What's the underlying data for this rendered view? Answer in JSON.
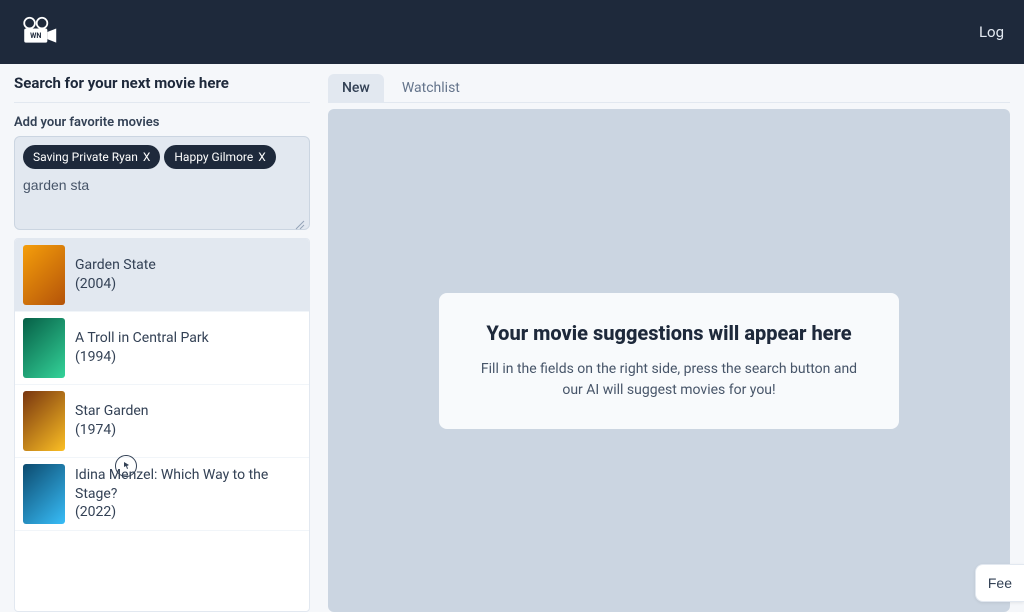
{
  "header": {
    "logo_label": "WN",
    "login_label": "Log"
  },
  "sidebar": {
    "heading": "Search for your next movie here",
    "field_label": "Add your favorite movies",
    "tags": [
      {
        "label": "Saving Private Ryan",
        "close": "X"
      },
      {
        "label": "Happy Gilmore",
        "close": "X"
      }
    ],
    "search_value": "garden sta",
    "suggestions": [
      {
        "title": "Garden State",
        "year": "(2004)",
        "hovered": true
      },
      {
        "title": "A Troll in Central Park",
        "year": "(1994)",
        "hovered": false
      },
      {
        "title": "Star Garden",
        "year": "(1974)",
        "hovered": false
      },
      {
        "title": "Idina Menzel: Which Way to the Stage?",
        "year": "(2022)",
        "hovered": false
      }
    ]
  },
  "tabs": [
    {
      "label": "New",
      "active": true
    },
    {
      "label": "Watchlist",
      "active": false
    }
  ],
  "empty_state": {
    "title": "Your movie suggestions will appear here",
    "description": "Fill in the fields on the right side, press the search button and our AI will suggest movies for you!"
  },
  "feedback_label": "Fee"
}
